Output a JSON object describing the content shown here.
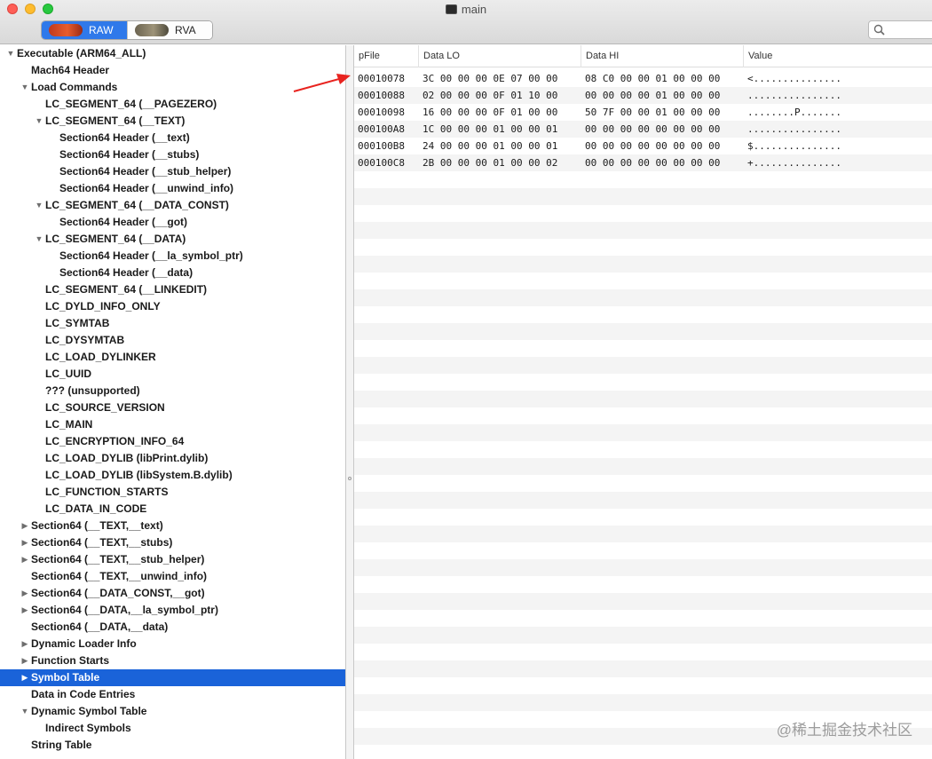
{
  "window": {
    "title": "main",
    "view_modes": [
      {
        "label": "RAW",
        "active": true
      },
      {
        "label": "RVA",
        "active": false
      }
    ],
    "search": {
      "placeholder": ""
    }
  },
  "sidebar": {
    "items": [
      {
        "label": "Executable  (ARM64_ALL)",
        "level": 0,
        "disclosure": "expanded"
      },
      {
        "label": "Mach64 Header",
        "level": 1,
        "disclosure": "none"
      },
      {
        "label": "Load Commands",
        "level": 1,
        "disclosure": "expanded"
      },
      {
        "label": "LC_SEGMENT_64 (__PAGEZERO)",
        "level": 2,
        "disclosure": "none"
      },
      {
        "label": "LC_SEGMENT_64 (__TEXT)",
        "level": 2,
        "disclosure": "expanded"
      },
      {
        "label": "Section64 Header (__text)",
        "level": 3,
        "disclosure": "none"
      },
      {
        "label": "Section64 Header (__stubs)",
        "level": 3,
        "disclosure": "none"
      },
      {
        "label": "Section64 Header (__stub_helper)",
        "level": 3,
        "disclosure": "none"
      },
      {
        "label": "Section64 Header (__unwind_info)",
        "level": 3,
        "disclosure": "none"
      },
      {
        "label": "LC_SEGMENT_64 (__DATA_CONST)",
        "level": 2,
        "disclosure": "expanded"
      },
      {
        "label": "Section64 Header (__got)",
        "level": 3,
        "disclosure": "none"
      },
      {
        "label": "LC_SEGMENT_64 (__DATA)",
        "level": 2,
        "disclosure": "expanded"
      },
      {
        "label": "Section64 Header (__la_symbol_ptr)",
        "level": 3,
        "disclosure": "none"
      },
      {
        "label": "Section64 Header (__data)",
        "level": 3,
        "disclosure": "none"
      },
      {
        "label": "LC_SEGMENT_64 (__LINKEDIT)",
        "level": 2,
        "disclosure": "none"
      },
      {
        "label": "LC_DYLD_INFO_ONLY",
        "level": 2,
        "disclosure": "none"
      },
      {
        "label": "LC_SYMTAB",
        "level": 2,
        "disclosure": "none"
      },
      {
        "label": "LC_DYSYMTAB",
        "level": 2,
        "disclosure": "none"
      },
      {
        "label": "LC_LOAD_DYLINKER",
        "level": 2,
        "disclosure": "none"
      },
      {
        "label": "LC_UUID",
        "level": 2,
        "disclosure": "none"
      },
      {
        "label": "??? (unsupported)",
        "level": 2,
        "disclosure": "none"
      },
      {
        "label": "LC_SOURCE_VERSION",
        "level": 2,
        "disclosure": "none"
      },
      {
        "label": "LC_MAIN",
        "level": 2,
        "disclosure": "none"
      },
      {
        "label": "LC_ENCRYPTION_INFO_64",
        "level": 2,
        "disclosure": "none"
      },
      {
        "label": "LC_LOAD_DYLIB (libPrint.dylib)",
        "level": 2,
        "disclosure": "none"
      },
      {
        "label": "LC_LOAD_DYLIB (libSystem.B.dylib)",
        "level": 2,
        "disclosure": "none"
      },
      {
        "label": "LC_FUNCTION_STARTS",
        "level": 2,
        "disclosure": "none"
      },
      {
        "label": "LC_DATA_IN_CODE",
        "level": 2,
        "disclosure": "none"
      },
      {
        "label": "Section64 (__TEXT,__text)",
        "level": 1,
        "disclosure": "collapsed"
      },
      {
        "label": "Section64 (__TEXT,__stubs)",
        "level": 1,
        "disclosure": "collapsed"
      },
      {
        "label": "Section64 (__TEXT,__stub_helper)",
        "level": 1,
        "disclosure": "collapsed"
      },
      {
        "label": "Section64 (__TEXT,__unwind_info)",
        "level": 1,
        "disclosure": "none"
      },
      {
        "label": "Section64 (__DATA_CONST,__got)",
        "level": 1,
        "disclosure": "collapsed"
      },
      {
        "label": "Section64 (__DATA,__la_symbol_ptr)",
        "level": 1,
        "disclosure": "collapsed"
      },
      {
        "label": "Section64 (__DATA,__data)",
        "level": 1,
        "disclosure": "none"
      },
      {
        "label": "Dynamic Loader Info",
        "level": 1,
        "disclosure": "collapsed"
      },
      {
        "label": "Function Starts",
        "level": 1,
        "disclosure": "collapsed"
      },
      {
        "label": "Symbol Table",
        "level": 1,
        "disclosure": "collapsed",
        "selected": true
      },
      {
        "label": "Data in Code Entries",
        "level": 1,
        "disclosure": "none"
      },
      {
        "label": "Dynamic Symbol Table",
        "level": 1,
        "disclosure": "expanded"
      },
      {
        "label": "Indirect Symbols",
        "level": 2,
        "disclosure": "none"
      },
      {
        "label": "String Table",
        "level": 1,
        "disclosure": "none"
      }
    ]
  },
  "table": {
    "columns": [
      "pFile",
      "Data LO",
      "Data HI",
      "Value"
    ],
    "rows": [
      [
        "00010078",
        "3C 00 00 00 0E 07 00 00",
        "08 C0 00 00 01 00 00 00",
        "<..............."
      ],
      [
        "00010088",
        "02 00 00 00 0F 01 10 00",
        "00 00 00 00 01 00 00 00",
        "................"
      ],
      [
        "00010098",
        "16 00 00 00 0F 01 00 00",
        "50 7F 00 00 01 00 00 00",
        "........P......."
      ],
      [
        "000100A8",
        "1C 00 00 00 01 00 00 01",
        "00 00 00 00 00 00 00 00",
        "................"
      ],
      [
        "000100B8",
        "24 00 00 00 01 00 00 01",
        "00 00 00 00 00 00 00 00",
        "$..............."
      ],
      [
        "000100C8",
        "2B 00 00 00 01 00 00 02",
        "00 00 00 00 00 00 00 00",
        "+..............."
      ]
    ]
  },
  "colors": {
    "selection": "#1a63d9",
    "segment_active": "#2f79ea",
    "annotation_arrow": "#e8231f"
  },
  "watermark": "@稀土掘金技术社区"
}
